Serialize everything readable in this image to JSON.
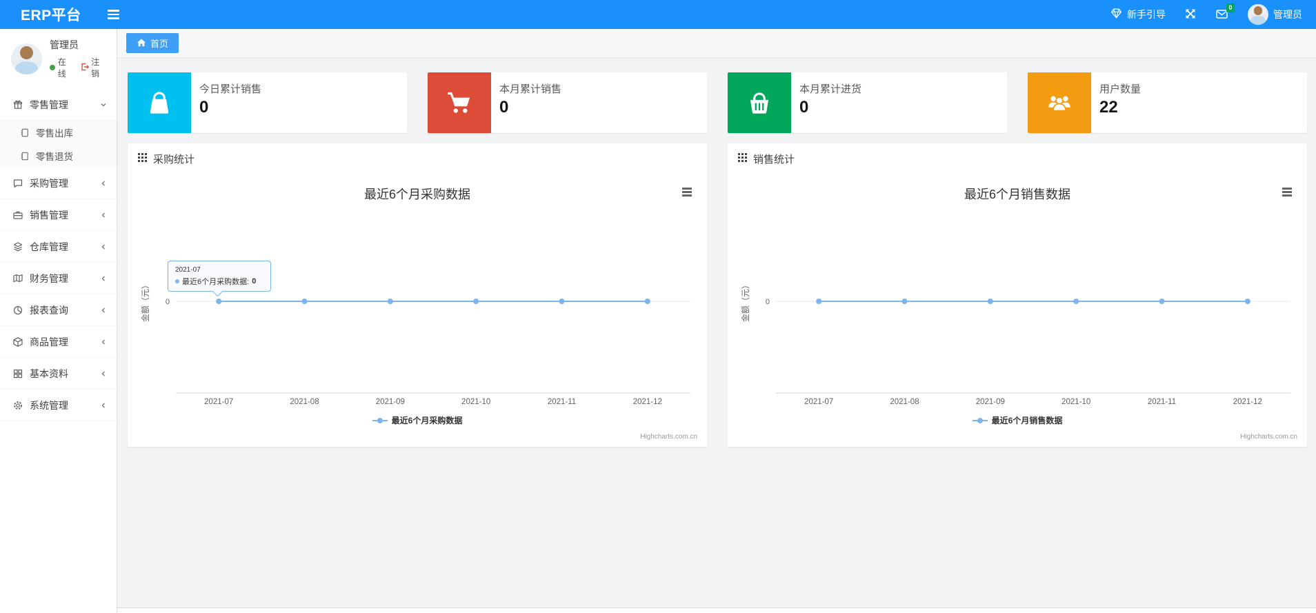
{
  "app": {
    "brand": "ERP平台"
  },
  "topbar": {
    "guide_label": "新手引导",
    "mail_badge": "0",
    "user_name": "管理员",
    "icons": [
      "gem-icon",
      "expand-arrows-icon",
      "envelope-icon",
      "avatar"
    ]
  },
  "sidebar": {
    "user": {
      "name": "管理员",
      "status": "在线",
      "logout": "注销"
    },
    "items": [
      {
        "label": "零售管理",
        "icon": "gift-icon",
        "chevron": "down",
        "expanded": true,
        "children": [
          {
            "label": "零售出库",
            "icon": "journal-icon"
          },
          {
            "label": "零售退货",
            "icon": "journal-icon"
          }
        ]
      },
      {
        "label": "采购管理",
        "icon": "chat-icon",
        "chevron": "left"
      },
      {
        "label": "销售管理",
        "icon": "briefcase-icon",
        "chevron": "left"
      },
      {
        "label": "仓库管理",
        "icon": "layers-icon",
        "chevron": "left"
      },
      {
        "label": "财务管理",
        "icon": "map-book-icon",
        "chevron": "left"
      },
      {
        "label": "报表查询",
        "icon": "pie-chart-icon",
        "chevron": "left"
      },
      {
        "label": "商品管理",
        "icon": "cube-icon",
        "chevron": "left"
      },
      {
        "label": "基本资料",
        "icon": "grid-icon",
        "chevron": "left"
      },
      {
        "label": "系统管理",
        "icon": "gear-icon",
        "chevron": "left"
      }
    ]
  },
  "tabs": [
    {
      "label": "首页",
      "icon": "home-icon",
      "active": true
    }
  ],
  "stat_cards": [
    {
      "label": "今日累计销售",
      "value": "0",
      "icon": "shopping-bag-icon",
      "color": "#00c0ef"
    },
    {
      "label": "本月累计销售",
      "value": "0",
      "icon": "shopping-cart-icon",
      "color": "#dd4b39"
    },
    {
      "label": "本月累计进货",
      "value": "0",
      "icon": "shopping-basket-icon",
      "color": "#00a65a"
    },
    {
      "label": "用户数量",
      "value": "22",
      "icon": "users-icon",
      "color": "#f39c12"
    }
  ],
  "chart_data": [
    {
      "type": "line",
      "panel_title": "采购统计",
      "panel_icon": "th-grid-icon",
      "export_icon": "hamburger-menu-icon",
      "title": "最近6个月采购数据",
      "categories": [
        "2021-07",
        "2021-08",
        "2021-09",
        "2021-10",
        "2021-11",
        "2021-12"
      ],
      "series": [
        {
          "name": "最近6个月采购数据",
          "values": [
            0,
            0,
            0,
            0,
            0,
            0
          ],
          "color": "#7cb5ec"
        }
      ],
      "ylabel": "金额（元）",
      "yticks": [
        0
      ],
      "grid": true,
      "legend_position": "bottom",
      "credit": "Highcharts.com.cn",
      "tooltip": {
        "visible": true,
        "category": "2021-07",
        "series_label": "最近6个月采购数据:",
        "value": "0"
      }
    },
    {
      "type": "line",
      "panel_title": "销售统计",
      "panel_icon": "th-grid-icon",
      "export_icon": "hamburger-menu-icon",
      "title": "最近6个月销售数据",
      "categories": [
        "2021-07",
        "2021-08",
        "2021-09",
        "2021-10",
        "2021-11",
        "2021-12"
      ],
      "series": [
        {
          "name": "最近6个月销售数据",
          "values": [
            0,
            0,
            0,
            0,
            0,
            0
          ],
          "color": "#7cb5ec"
        }
      ],
      "ylabel": "金额（元）",
      "yticks": [
        0
      ],
      "grid": true,
      "legend_position": "bottom",
      "credit": "Highcharts.com.cn",
      "tooltip": {
        "visible": false
      }
    }
  ]
}
